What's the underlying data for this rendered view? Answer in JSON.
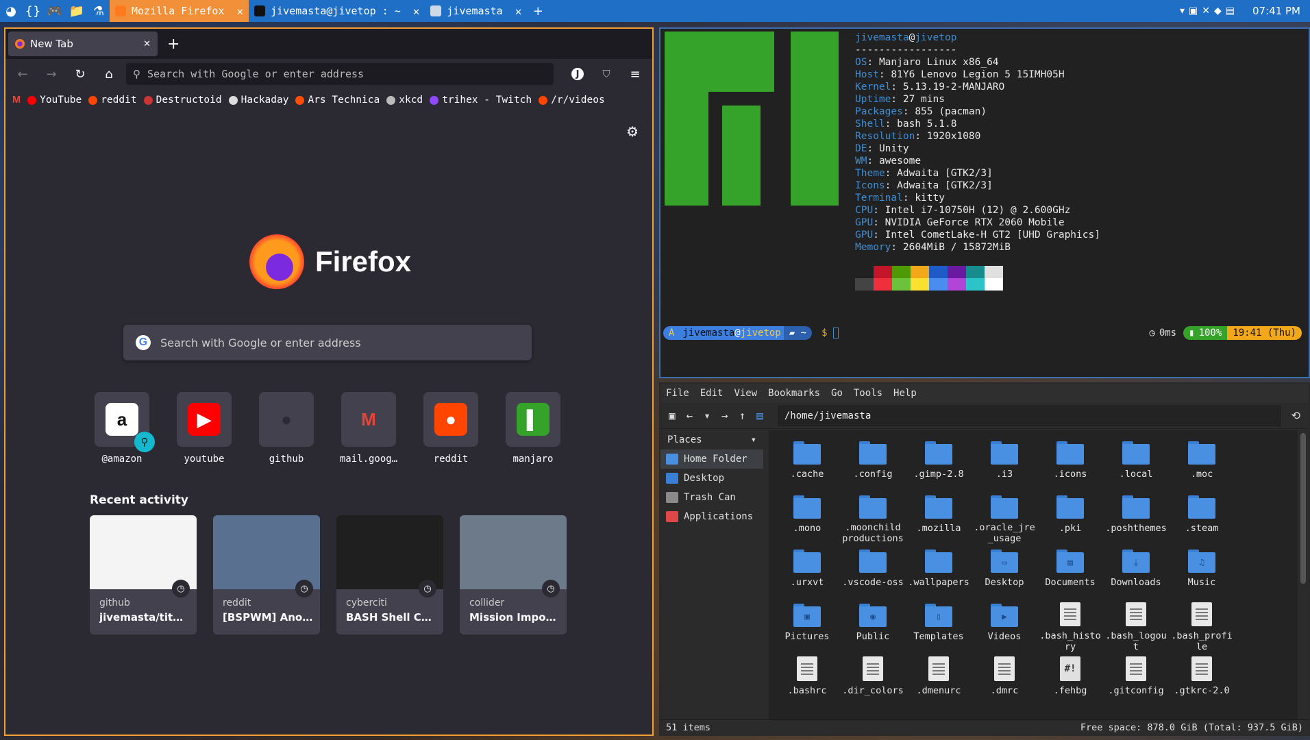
{
  "topbar": {
    "launchers": [
      {
        "icon": "manjaro-icon",
        "glyph": "◕"
      },
      {
        "icon": "code-braces-icon",
        "glyph": "{}"
      },
      {
        "icon": "terminal-icon",
        "glyph": ">_"
      },
      {
        "icon": "gamepad-icon",
        "glyph": "🎮"
      },
      {
        "icon": "folder-icon",
        "glyph": "📁"
      },
      {
        "icon": "flask-icon",
        "glyph": "⚗"
      }
    ],
    "tasks": [
      {
        "label": "Mozilla Firefox",
        "active": true
      },
      {
        "label": "jivemasta@jivetop : ~",
        "active": false
      },
      {
        "label": "jivemasta",
        "active": false
      }
    ],
    "add_glyph": "+",
    "close_glyph": "✕",
    "clock": "07:41 PM",
    "colors": {
      "bar": "#1f6fc7",
      "active_task": "#f28f39"
    }
  },
  "firefox": {
    "tab_title": "New Tab",
    "new_tab_glyph": "+",
    "url_placeholder": "Search with Google or enter address",
    "bookmarks": [
      {
        "label": "YouTube",
        "color": "#ff0000"
      },
      {
        "label": "reddit",
        "color": "#ff4500"
      },
      {
        "label": "Destructoid",
        "color": "#cc3333"
      },
      {
        "label": "Hackaday",
        "color": "#dddddd"
      },
      {
        "label": "Ars Technica",
        "color": "#ff4e00"
      },
      {
        "label": "xkcd",
        "color": "#bbbbbb"
      },
      {
        "label": "trihex - Twitch",
        "color": "#9146ff"
      },
      {
        "label": "/r/videos",
        "color": "#ff4500"
      }
    ],
    "wordmark": "Firefox",
    "search_placeholder": "Search with Google or enter address",
    "top_sites": [
      {
        "label": "@amazon",
        "glyph": "a",
        "bg": "#ffffff",
        "fg": "#111111"
      },
      {
        "label": "youtube",
        "glyph": "▶",
        "bg": "#ff0000",
        "fg": "#ffffff"
      },
      {
        "label": "github",
        "glyph": "●",
        "bg": "#42414d",
        "fg": "#2b2a33"
      },
      {
        "label": "mail.goog…",
        "glyph": "M",
        "bg": "#42414d",
        "fg": "#ea4335"
      },
      {
        "label": "reddit",
        "glyph": "●",
        "bg": "#ff4500",
        "fg": "#ffffff"
      },
      {
        "label": "manjaro",
        "glyph": "▌",
        "bg": "#35a22a",
        "fg": "#ffffff"
      }
    ],
    "recent_title": "Recent activity",
    "recent": [
      {
        "source": "github",
        "title": "jivemasta/tit…",
        "thumb_bg": "#f4f4f4"
      },
      {
        "source": "reddit",
        "title": "[BSPWM] Ano…",
        "thumb_bg": "#5a7090"
      },
      {
        "source": "cyberciti",
        "title": "BASH Shell C…",
        "thumb_bg": "#1f1f1f"
      },
      {
        "source": "collider",
        "title": "Mission Impo…",
        "thumb_bg": "#6d7a8a"
      }
    ]
  },
  "terminal": {
    "header_user": "jivemasta",
    "header_at": "@",
    "header_host": "jivetop",
    "separator": "-----------------",
    "info": [
      {
        "k": "OS",
        "v": "Manjaro Linux x86_64"
      },
      {
        "k": "Host",
        "v": "81Y6 Lenovo Legion 5 15IMH05H"
      },
      {
        "k": "Kernel",
        "v": "5.13.19-2-MANJARO"
      },
      {
        "k": "Uptime",
        "v": "27 mins"
      },
      {
        "k": "Packages",
        "v": "855 (pacman)"
      },
      {
        "k": "Shell",
        "v": "bash 5.1.8"
      },
      {
        "k": "Resolution",
        "v": "1920x1080"
      },
      {
        "k": "DE",
        "v": "Unity"
      },
      {
        "k": "WM",
        "v": "awesome"
      },
      {
        "k": "Theme",
        "v": "Adwaita [GTK2/3]"
      },
      {
        "k": "Icons",
        "v": "Adwaita [GTK2/3]"
      },
      {
        "k": "Terminal",
        "v": "kitty"
      },
      {
        "k": "CPU",
        "v": "Intel i7-10750H (12) @ 2.600GHz"
      },
      {
        "k": "GPU",
        "v": "NVIDIA GeForce RTX 2060 Mobile"
      },
      {
        "k": "GPU",
        "v": "Intel CometLake-H GT2 [UHD Graphics]"
      },
      {
        "k": "Memory",
        "v": "2604MiB / 15872MiB"
      }
    ],
    "swatch_colors_top": [
      "#212121",
      "#c4162a",
      "#4e9a06",
      "#f2a818",
      "#1f5bc7",
      "#6a1aa0",
      "#178c8c",
      "#e0e0e0"
    ],
    "swatch_colors_bottom": [
      "#444444",
      "#ef2f3c",
      "#6cc23a",
      "#fbe032",
      "#4a8cf0",
      "#b145d8",
      "#2bc5c9",
      "#ffffff"
    ],
    "prompt": {
      "arch_glyph": "A",
      "user": "jivemasta",
      "at": "@",
      "host": "jivetop",
      "dir_glyph": "▰",
      "dir": "~",
      "dollar": "$",
      "duration_glyph": "◷",
      "duration": "0ms",
      "battery": "100%",
      "time": "19:41 (Thu)"
    }
  },
  "filemanager": {
    "menu": [
      "File",
      "Edit",
      "View",
      "Bookmarks",
      "Go",
      "Tools",
      "Help"
    ],
    "path": "/home/jivemasta",
    "places_label": "Places",
    "places": [
      {
        "label": "Home Folder",
        "selected": true,
        "color": "#4a90e2"
      },
      {
        "label": "Desktop",
        "selected": false,
        "color": "#3a7fd6"
      },
      {
        "label": "Trash Can",
        "selected": false,
        "color": "#8a8a8a"
      },
      {
        "label": "Applications",
        "selected": false,
        "color": "#e04848"
      }
    ],
    "files": [
      {
        "name": ".cache",
        "kind": "folder",
        "emblem": ""
      },
      {
        "name": ".config",
        "kind": "folder",
        "emblem": ""
      },
      {
        "name": ".gimp-2.8",
        "kind": "folder",
        "emblem": ""
      },
      {
        "name": ".i3",
        "kind": "folder",
        "emblem": ""
      },
      {
        "name": ".icons",
        "kind": "folder",
        "emblem": ""
      },
      {
        "name": ".local",
        "kind": "folder",
        "emblem": ""
      },
      {
        "name": ".moc",
        "kind": "folder",
        "emblem": ""
      },
      {
        "name": ".mono",
        "kind": "folder",
        "emblem": ""
      },
      {
        "name": ".moonchild productions",
        "kind": "folder",
        "emblem": ""
      },
      {
        "name": ".mozilla",
        "kind": "folder",
        "emblem": ""
      },
      {
        "name": ".oracle_j­re_usage",
        "kind": "folder",
        "emblem": ""
      },
      {
        "name": ".pki",
        "kind": "folder",
        "emblem": ""
      },
      {
        "name": ".poshthemes",
        "kind": "folder",
        "emblem": ""
      },
      {
        "name": ".steam",
        "kind": "folder",
        "emblem": ""
      },
      {
        "name": ".urxvt",
        "kind": "folder",
        "emblem": ""
      },
      {
        "name": ".vscode-oss",
        "kind": "folder",
        "emblem": ""
      },
      {
        "name": ".wallpapers",
        "kind": "folder",
        "emblem": ""
      },
      {
        "name": "Desktop",
        "kind": "folder",
        "emblem": "▭"
      },
      {
        "name": "Documents",
        "kind": "folder",
        "emblem": "▤"
      },
      {
        "name": "Downloads",
        "kind": "folder",
        "emblem": "⤓"
      },
      {
        "name": "Music",
        "kind": "folder",
        "emblem": "♫"
      },
      {
        "name": "Pictures",
        "kind": "folder",
        "emblem": "▣"
      },
      {
        "name": "Public",
        "kind": "folder",
        "emblem": "◉"
      },
      {
        "name": "Templates",
        "kind": "folder",
        "emblem": "▯"
      },
      {
        "name": "Videos",
        "kind": "folder",
        "emblem": "▶"
      },
      {
        "name": ".bash_his­tory",
        "kind": "doc",
        "emblem": ""
      },
      {
        "name": ".bash_log­out",
        "kind": "doc",
        "emblem": ""
      },
      {
        "name": ".bash_pro­file",
        "kind": "doc",
        "emblem": ""
      },
      {
        "name": ".bashrc",
        "kind": "doc",
        "emblem": ""
      },
      {
        "name": ".dir_colors",
        "kind": "doc",
        "emblem": ""
      },
      {
        "name": ".dmenurc",
        "kind": "doc",
        "emblem": ""
      },
      {
        "name": ".dmrc",
        "kind": "doc",
        "emblem": ""
      },
      {
        "name": ".fehbg",
        "kind": "script",
        "emblem": "#!"
      },
      {
        "name": ".gitconfig",
        "kind": "doc",
        "emblem": ""
      },
      {
        "name": ".gtkrc-2.0",
        "kind": "doc",
        "emblem": ""
      }
    ],
    "status_left": "51 items",
    "status_right": "Free space: 878.0 GiB (Total: 937.5 GiB)"
  }
}
